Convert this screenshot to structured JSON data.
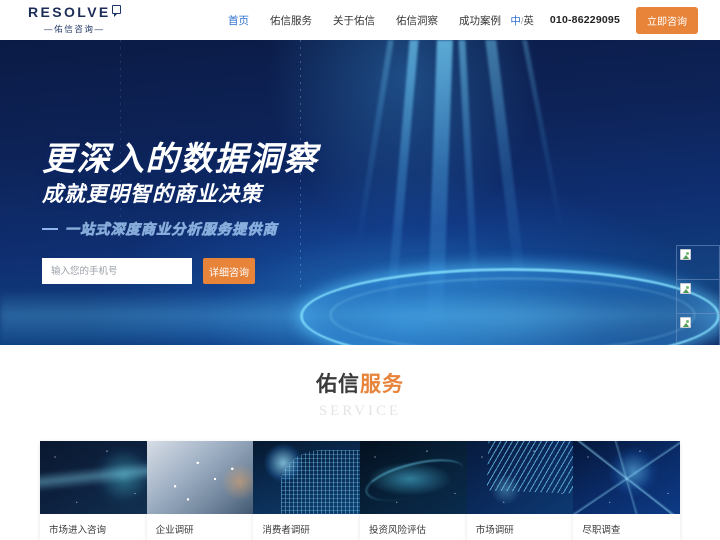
{
  "header": {
    "logo": {
      "brand": "RESOLVE",
      "sub": "—佑信咨询—",
      "bubble_icon": "speech-bubble-icon"
    },
    "nav": [
      {
        "label": "首页",
        "active": true
      },
      {
        "label": "佑信服务",
        "active": false
      },
      {
        "label": "关于佑信",
        "active": false
      },
      {
        "label": "佑信洞察",
        "active": false
      },
      {
        "label": "成功案例",
        "active": false
      }
    ],
    "lang_cn": "中",
    "lang_sep": "/",
    "lang_en": "英",
    "phone": "010-86229095",
    "cta_label": "立即咨询",
    "cta_color": "#e8833a"
  },
  "hero": {
    "headline": "更深入的数据洞察",
    "subheadline": "成就更明智的商业决策",
    "tagline": "一站式深度商业分析服务提供商",
    "input_placeholder": "输入您的手机号",
    "input_value": "",
    "submit_label": "详细咨询",
    "submit_color": "#e8833a",
    "bg_color": "#0d2256"
  },
  "side_panel": {
    "items": [
      {
        "icon": "broken-image-icon"
      },
      {
        "icon": "broken-image-icon"
      },
      {
        "icon": "broken-image-icon"
      },
      {
        "icon": "broken-image-icon"
      },
      {
        "icon": ""
      }
    ]
  },
  "service": {
    "title_dark": "佑信",
    "title_accent": "服务",
    "subtitle": "SERVICE",
    "accent_color": "#e8833a",
    "cards": [
      {
        "label": "市场进入咨询",
        "art": "art1"
      },
      {
        "label": "企业调研",
        "art": "art2"
      },
      {
        "label": "消费者调研",
        "art": "art3"
      },
      {
        "label": "投资风险评估",
        "art": "art4"
      },
      {
        "label": "市场调研",
        "art": "art5"
      },
      {
        "label": "尽职调查",
        "art": "art6"
      }
    ]
  }
}
